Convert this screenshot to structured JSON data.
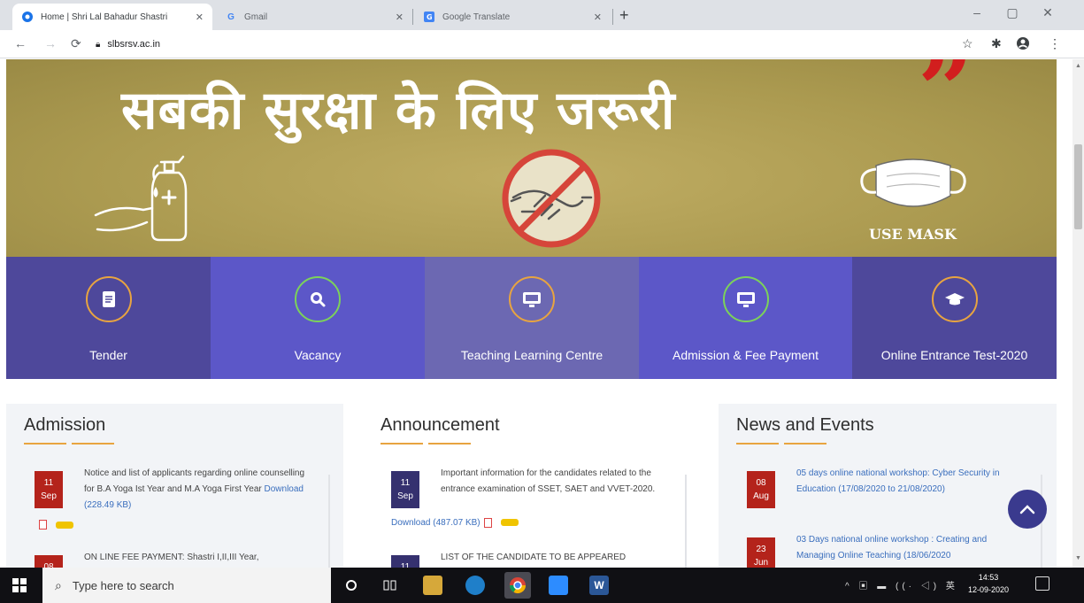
{
  "browser": {
    "tabs": [
      {
        "title": "Home | Shri Lal Bahadur Shastri",
        "favicon": "site-icon",
        "active": true
      },
      {
        "title": "Gmail",
        "favicon": "google-icon",
        "active": false
      },
      {
        "title": "Google Translate",
        "favicon": "translate-icon",
        "active": false
      }
    ],
    "url": "slbsrsv.ac.in"
  },
  "banner": {
    "headline": "सबकी सुरक्षा के लिए जरूरी",
    "quote_mark": "”",
    "mask_label": "USE MASK"
  },
  "tiles": [
    {
      "label": "Tender",
      "icon": "document-icon",
      "color": "#4e489b"
    },
    {
      "label": "Vacancy",
      "icon": "search-icon",
      "color": "#5c57c8"
    },
    {
      "label": "Teaching Learning Centre",
      "icon": "monitor-icon",
      "color": "#6c68b2"
    },
    {
      "label": "Admission & Fee Payment",
      "icon": "monitor-icon",
      "color": "#5c57c8"
    },
    {
      "label": "Online Entrance Test-2020",
      "icon": "graduation-cap-icon",
      "color": "#4e489b"
    }
  ],
  "admission": {
    "title": "Admission",
    "items": [
      {
        "day": "11",
        "month": "Sep",
        "text": "Notice and list of applicants regarding online counselling for B.A Yoga Ist Year and M.A Yoga First Year",
        "link": "Download (228.49 KB)"
      },
      {
        "day": "08",
        "month": "",
        "text": "ON LINE FEE PAYMENT: Shastri I,II,III Year,"
      }
    ]
  },
  "announcement": {
    "title": "Announcement",
    "items": [
      {
        "day": "11",
        "month": "Sep",
        "text": "Important information for the candidates related to the entrance examination of SSET, SAET and VVET-2020.",
        "link": "Download (487.07 KB)"
      },
      {
        "day": "11",
        "month": "",
        "text": "LIST OF THE CANDIDATE TO BE APPEARED"
      }
    ]
  },
  "news": {
    "title": "News and Events",
    "items": [
      {
        "day": "08",
        "month": "Aug",
        "text": "05 days online national workshop: Cyber Security in Education (17/08/2020 to 21/08/2020)"
      },
      {
        "day": "23",
        "month": "Jun",
        "text": "03 Days national online workshop : Creating and Managing Online Teaching (18/06/2020"
      }
    ]
  },
  "taskbar": {
    "search_placeholder": "Type here to search",
    "time": "14:53",
    "date": "12-09-2020"
  },
  "colors": {
    "date_red": "#b4231b",
    "date_navy": "#35316f",
    "accent_orange": "#e8a440",
    "link_blue": "#3a6ebd"
  }
}
